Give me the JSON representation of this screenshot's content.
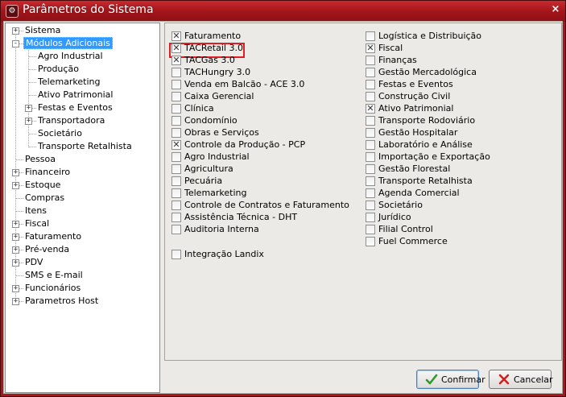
{
  "window": {
    "title": "Parâmetros do Sistema",
    "close_glyph": "×",
    "icon_glyph": "⚙"
  },
  "tree": {
    "items": [
      {
        "label": "Sistema",
        "expander": "+"
      },
      {
        "label": "Módulos Adicionais",
        "expander": "-",
        "selected": true
      },
      {
        "label": "Agro Industrial"
      },
      {
        "label": "Produção"
      },
      {
        "label": "Telemarketing"
      },
      {
        "label": "Ativo Patrimonial"
      },
      {
        "label": "Festas e Eventos",
        "expander": "+"
      },
      {
        "label": "Transportadora",
        "expander": "+"
      },
      {
        "label": "Societário"
      },
      {
        "label": "Transporte Retalhista"
      },
      {
        "label": "Pessoa"
      },
      {
        "label": "Financeiro",
        "expander": "+"
      },
      {
        "label": "Estoque",
        "expander": "+"
      },
      {
        "label": "Compras"
      },
      {
        "label": "Itens"
      },
      {
        "label": "Fiscal",
        "expander": "+"
      },
      {
        "label": "Faturamento",
        "expander": "+"
      },
      {
        "label": "Pré-venda",
        "expander": "+"
      },
      {
        "label": "PDV",
        "expander": "+"
      },
      {
        "label": "SMS e E-mail"
      },
      {
        "label": "Funcionários",
        "expander": "+"
      },
      {
        "label": "Parametros Host",
        "expander": "+"
      }
    ]
  },
  "modules_left": [
    {
      "label": "Faturamento",
      "checked": true
    },
    {
      "label": "TACRetail 3.0",
      "checked": true
    },
    {
      "label": "TACGas 3.0",
      "checked": true
    },
    {
      "label": "TACHungry 3.0",
      "checked": false
    },
    {
      "label": "Venda em Balcão - ACE 3.0",
      "checked": false
    },
    {
      "label": "Caixa Gerencial",
      "checked": false
    },
    {
      "label": "Clínica",
      "checked": false
    },
    {
      "label": "Condomínio",
      "checked": false
    },
    {
      "label": "Obras e Serviços",
      "checked": false
    },
    {
      "label": "Controle da Produção - PCP",
      "checked": true
    },
    {
      "label": "Agro Industrial",
      "checked": false
    },
    {
      "label": "Agricultura",
      "checked": false
    },
    {
      "label": "Pecuária",
      "checked": false
    },
    {
      "label": "Telemarketing",
      "checked": false
    },
    {
      "label": "Controle de Contratos e Faturamento",
      "checked": false
    },
    {
      "label": "Assistência Técnica - DHT",
      "checked": false
    },
    {
      "label": "Auditoria Interna",
      "checked": false
    }
  ],
  "modules_extra": {
    "label": "Integração Landix",
    "checked": false
  },
  "modules_right": [
    {
      "label": "Logística e Distribuição",
      "checked": false
    },
    {
      "label": "Fiscal",
      "checked": true
    },
    {
      "label": "Finanças",
      "checked": false
    },
    {
      "label": "Gestão Mercadológica",
      "checked": false
    },
    {
      "label": "Festas e Eventos",
      "checked": false
    },
    {
      "label": "Construção Civil",
      "checked": false
    },
    {
      "label": "Ativo Patrimonial",
      "checked": true
    },
    {
      "label": "Transporte Rodoviário",
      "checked": false
    },
    {
      "label": "Gestão Hospitalar",
      "checked": false
    },
    {
      "label": "Laboratório e Análise",
      "checked": false
    },
    {
      "label": "Importação e Exportação",
      "checked": false
    },
    {
      "label": "Gestão Florestal",
      "checked": false
    },
    {
      "label": "Transporte Retalhista",
      "checked": false
    },
    {
      "label": "Agenda Comercial",
      "checked": false
    },
    {
      "label": "Societário",
      "checked": false
    },
    {
      "label": "Jurídico",
      "checked": false
    },
    {
      "label": "Filial Control",
      "checked": false
    },
    {
      "label": "Fuel Commerce",
      "checked": false
    }
  ],
  "buttons": {
    "confirm": "Confirmar",
    "cancel": "Cancelar"
  },
  "colors": {
    "titlebar": "#a3161b",
    "highlight_border": "#e21b24",
    "selected_bg": "#3399ff",
    "confirm_icon": "#2e9a2e",
    "cancel_icon": "#d0201f"
  }
}
